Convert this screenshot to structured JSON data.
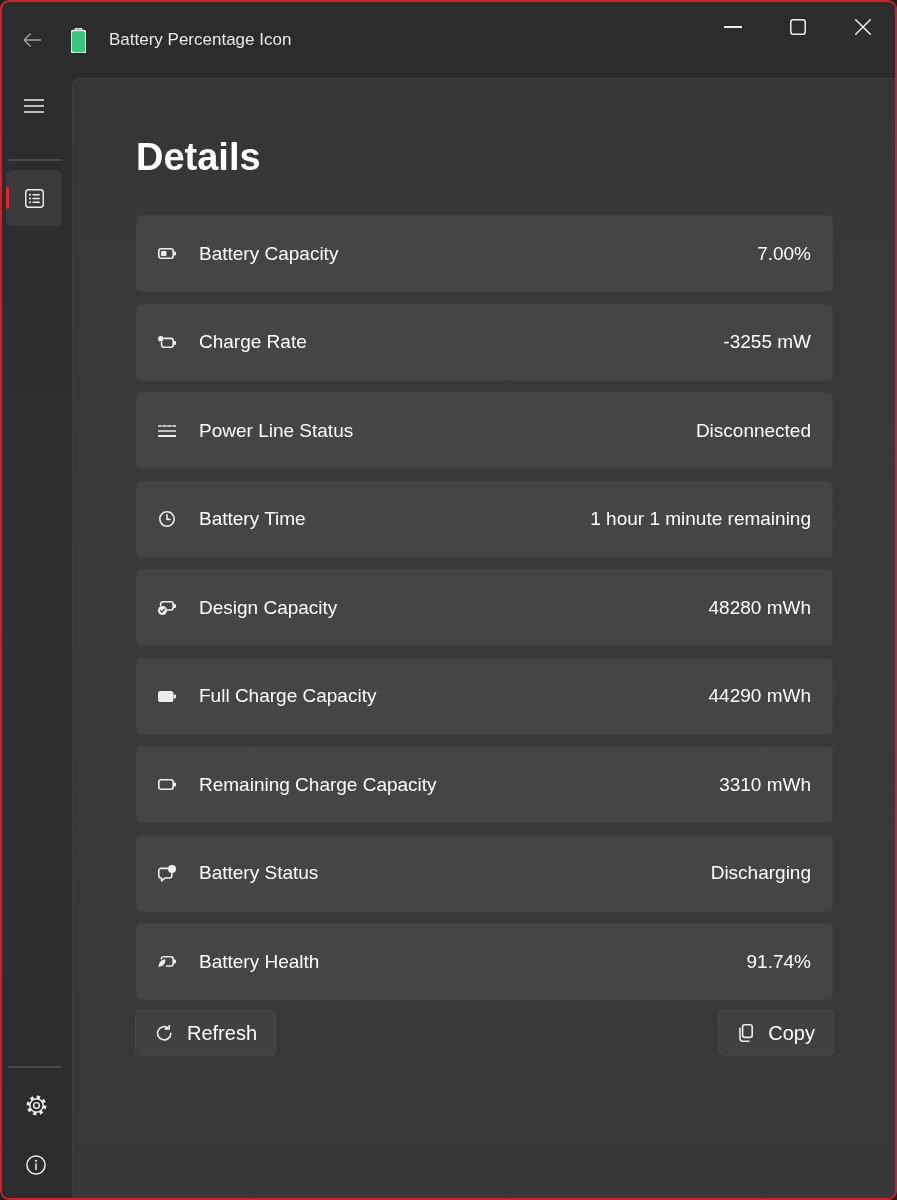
{
  "window": {
    "title": "Battery Percentage Icon"
  },
  "sidebar": {
    "items": [
      {
        "selected": true
      }
    ]
  },
  "heading": "Details",
  "details": [
    {
      "label": "Battery Capacity",
      "value": "7.00%"
    },
    {
      "label": "Charge Rate",
      "value": "-3255 mW"
    },
    {
      "label": "Power Line Status",
      "value": "Disconnected"
    },
    {
      "label": "Battery Time",
      "value": "1 hour 1 minute remaining"
    },
    {
      "label": "Design Capacity",
      "value": "48280 mWh"
    },
    {
      "label": "Full Charge Capacity",
      "value": "44290 mWh"
    },
    {
      "label": "Remaining Charge Capacity",
      "value": "3310 mWh"
    },
    {
      "label": "Battery Status",
      "value": "Discharging"
    },
    {
      "label": "Battery Health",
      "value": "91.74%"
    }
  ],
  "buttons": [
    "Refresh",
    "Copy"
  ]
}
